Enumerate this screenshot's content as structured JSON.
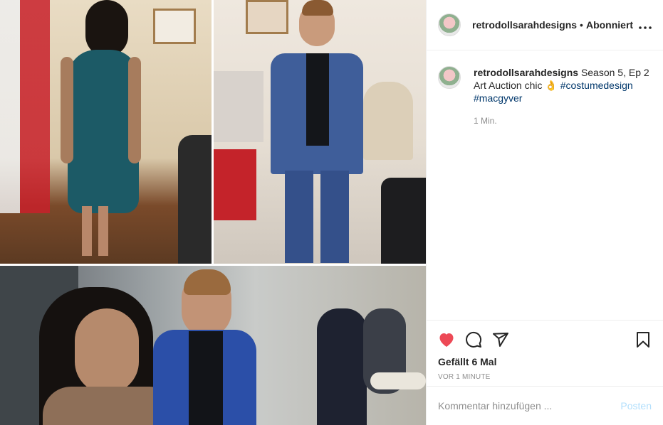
{
  "header": {
    "username": "retrodollsarahdesigns",
    "separator": "•",
    "follow_status": "Abonniert",
    "more_icon": "more-horizontal-icon"
  },
  "caption": {
    "username": "retrodollsarahdesigns",
    "text": "Season 5, Ep 2 Art Auction chic 👌",
    "hashtags": [
      "#costumedesign",
      "#macgyver"
    ],
    "time": "1 Min."
  },
  "actions": {
    "like_icon": "heart-filled-icon",
    "comment_icon": "comment-icon",
    "share_icon": "share-icon",
    "save_icon": "bookmark-icon",
    "like_color": "#ed4956"
  },
  "likes": "Gefällt 6 Mal",
  "posted_ago": "VOR 1 MINUTE",
  "comment": {
    "placeholder": "Kommentar hinzufügen ...",
    "submit_label": "Posten"
  }
}
